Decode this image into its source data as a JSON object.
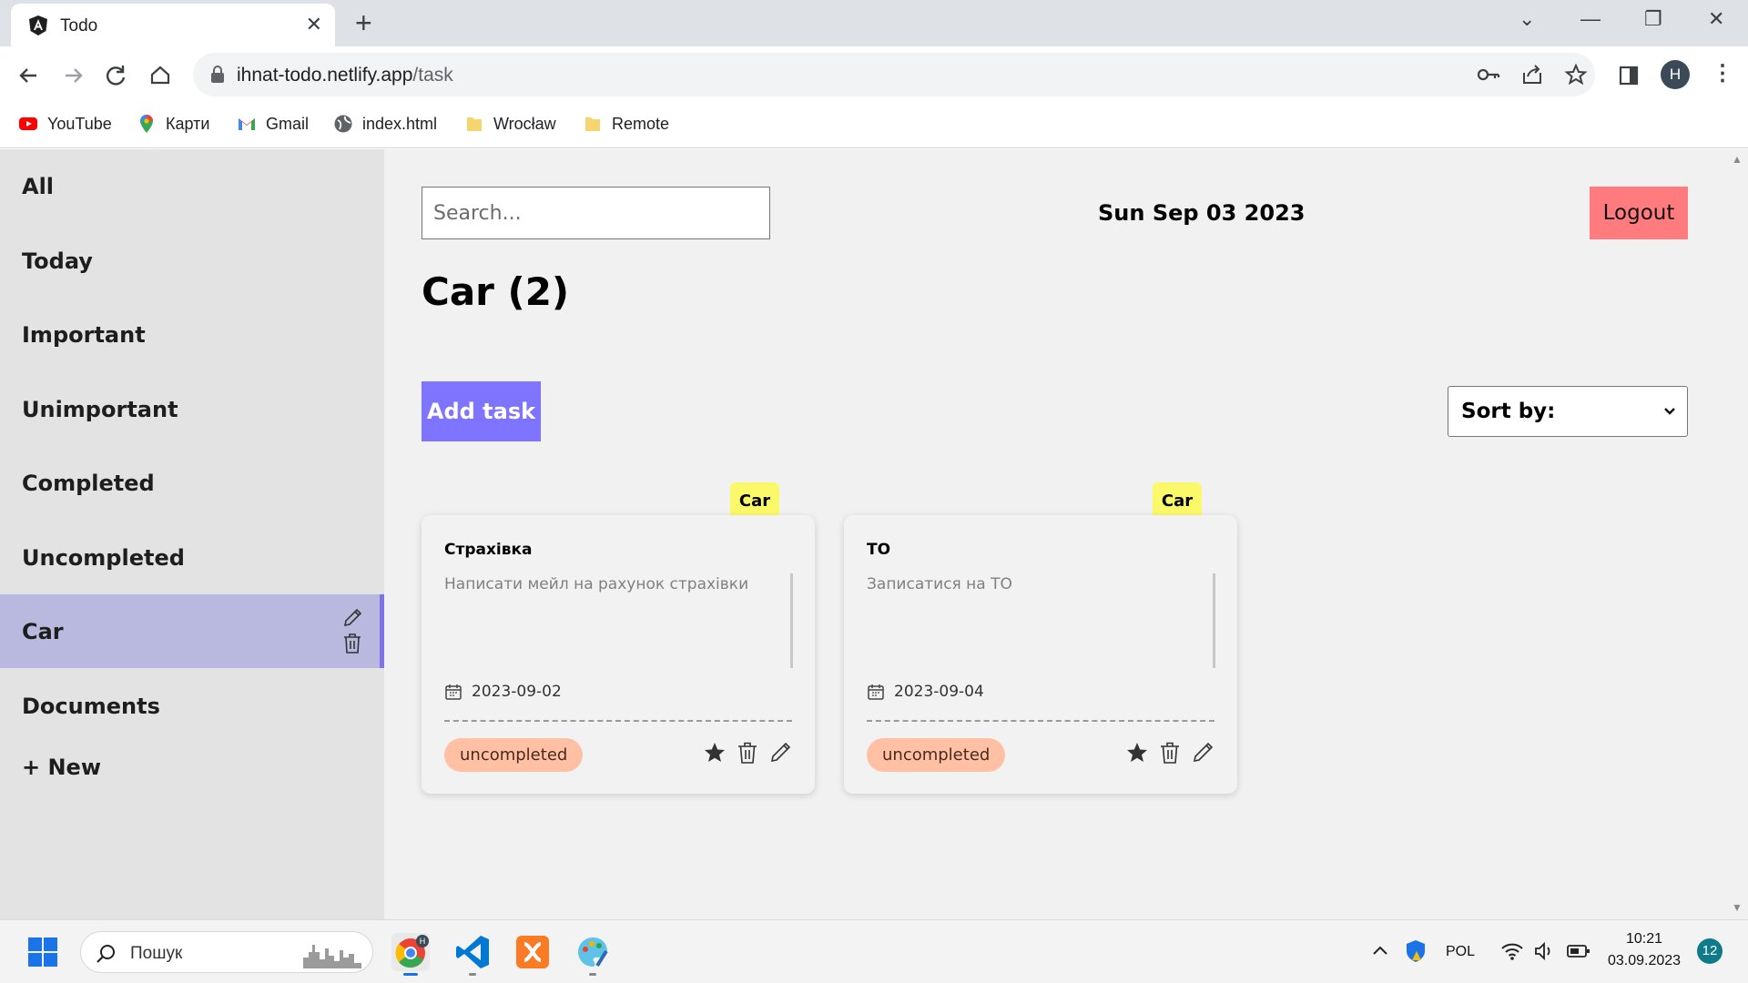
{
  "browser": {
    "tab_title": "Todo",
    "url_host": "ihnat-todo.netlify.app",
    "url_path": "/task",
    "profile_initial": "H",
    "bookmarks": [
      "YouTube",
      "Карти",
      "Gmail",
      "index.html",
      "Wrocław",
      "Remote"
    ]
  },
  "sidebar": {
    "items": [
      "All",
      "Today",
      "Important",
      "Unimportant",
      "Completed",
      "Uncompleted",
      "Car",
      "Documents"
    ],
    "new_label": "+ New",
    "active": "Car"
  },
  "header": {
    "search_placeholder": "Search...",
    "date": "Sun Sep 03 2023",
    "logout_label": "Logout"
  },
  "main": {
    "title": "Car (2)",
    "add_task_label": "Add task",
    "sort_label": "Sort by:"
  },
  "tasks": [
    {
      "tag": "Car",
      "title": "Страхівка",
      "description": "Написати мейл на рахунок страхівки",
      "date": "2023-09-02",
      "status": "uncompleted"
    },
    {
      "tag": "Car",
      "title": "ТО",
      "description": "Записатися на ТО",
      "date": "2023-09-04",
      "status": "uncompleted"
    }
  ],
  "taskbar": {
    "search_placeholder": "Пошук",
    "lang": "POL",
    "time": "10:21",
    "date": "03.09.2023",
    "notifications": "12"
  },
  "colors": {
    "accent": "#7e74ff",
    "logout": "#ff7b7e",
    "tag": "#fbf86a",
    "status": "#ffc0a3",
    "sidebar_active": "#b9b9df"
  }
}
